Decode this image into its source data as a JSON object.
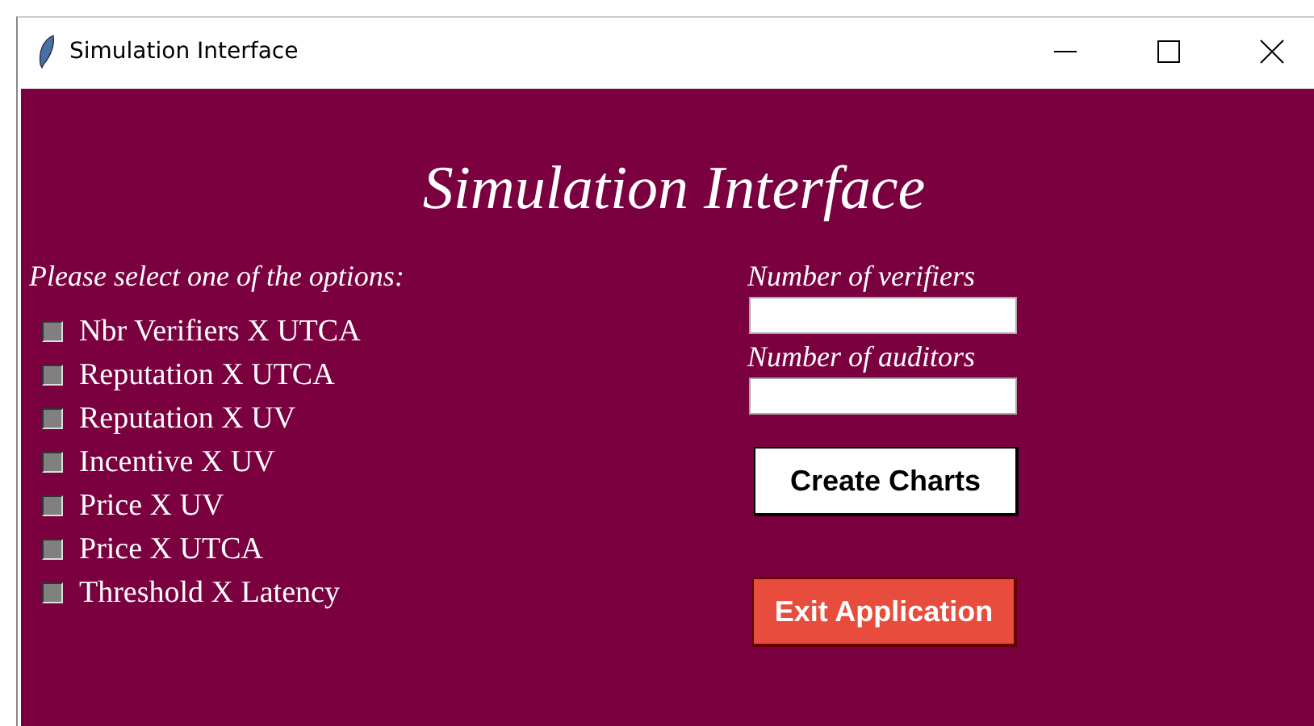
{
  "window": {
    "title": "Simulation Interface"
  },
  "heading": "Simulation Interface",
  "prompt": "Please select one of the options:",
  "options": [
    {
      "label": "Nbr Verifiers X UTCA",
      "checked": false
    },
    {
      "label": "Reputation X UTCA",
      "checked": false
    },
    {
      "label": "Reputation X UV",
      "checked": false
    },
    {
      "label": "Incentive X UV",
      "checked": false
    },
    {
      "label": "Price X UV",
      "checked": false
    },
    {
      "label": "Price X UTCA",
      "checked": false
    },
    {
      "label": "Threshold X Latency",
      "checked": false
    }
  ],
  "fields": [
    {
      "label": "Number of verifiers"
    },
    {
      "label": "Number of auditors"
    }
  ],
  "buttons": [
    {
      "label": "Create Charts",
      "kind": "primary"
    },
    {
      "label": "Exit Application",
      "kind": "danger"
    }
  ]
}
